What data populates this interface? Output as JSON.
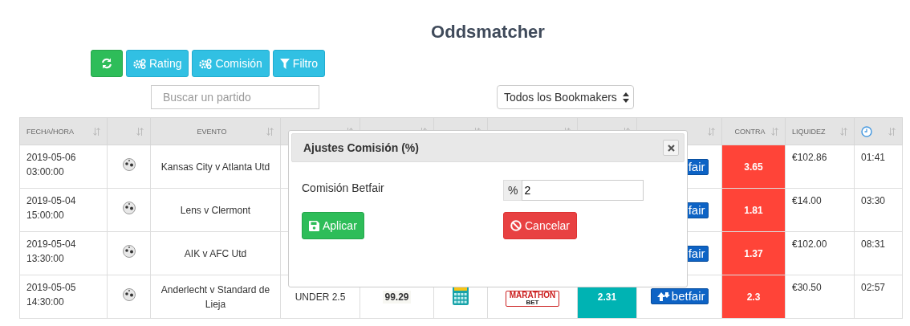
{
  "title": "Oddsmatcher",
  "toolbar": [
    {
      "kind": "refresh"
    },
    {
      "kind": "gears",
      "label": "Rating"
    },
    {
      "kind": "gears",
      "label": "Comisión"
    },
    {
      "kind": "filter",
      "label": "Filtro"
    }
  ],
  "search": {
    "placeholder": "Buscar un partido"
  },
  "bookmaker_select": {
    "value": "Todos los Bookmakers"
  },
  "table": {
    "columns": [
      {
        "kind": "text",
        "label": "FECHA/HORA"
      },
      {
        "kind": "blank"
      },
      {
        "kind": "centered",
        "label": "EVENTO"
      },
      {
        "kind": "hidden"
      },
      {
        "kind": "hidden"
      },
      {
        "kind": "hidden"
      },
      {
        "kind": "hidden"
      },
      {
        "kind": "hidden"
      },
      {
        "kind": "hidden"
      },
      {
        "kind": "centered",
        "label": "CONTRA"
      },
      {
        "kind": "text",
        "label": "LIQUIDEZ"
      },
      {
        "kind": "clock"
      }
    ],
    "rows": [
      {
        "date": "2019-05-06",
        "time": "03:00:00",
        "event": "Kansas City v Atlanta Utd",
        "exchange": "fair",
        "contra": "3.65",
        "liquidity": "€102.86",
        "countdown": "01:41"
      },
      {
        "date": "2019-05-04",
        "time": "15:00:00",
        "event": "Lens v Clermont",
        "exchange": "fair",
        "contra": "1.81",
        "liquidity": "€14.00",
        "countdown": "03:30"
      },
      {
        "date": "2019-05-04",
        "time": "13:30:00",
        "event": "AIK v AFC Utd",
        "exchange": "fair",
        "contra": "1.37",
        "liquidity": "€102.00",
        "countdown": "08:31"
      },
      {
        "date": "2019-05-05",
        "time": "14:30:00",
        "event": "Anderlecht v Standard de Lieja",
        "line": "UNDER 2.5",
        "rating": "99.29",
        "bookmaker": [
          "MARATHON",
          "BET"
        ],
        "favor": "2.31",
        "exchange": "betfair",
        "contra": "2.3",
        "liquidity": "€30.50",
        "countdown": "02:57"
      }
    ]
  },
  "modal": {
    "title": "Ajustes Comisión (%)",
    "label": "Comisión Betfair",
    "addon": "%",
    "value": "2",
    "apply": "Aplicar",
    "cancel": "Cancelar"
  }
}
